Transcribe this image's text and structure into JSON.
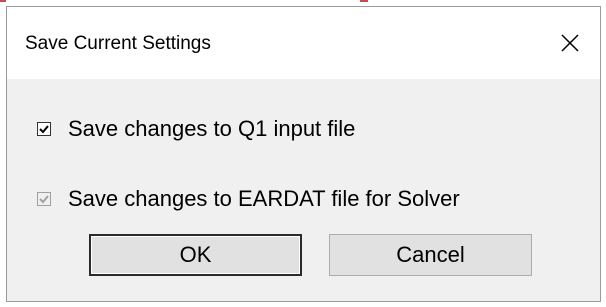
{
  "dialog": {
    "title": "Save Current Settings",
    "close_icon": "close-icon"
  },
  "options": [
    {
      "label": "Save changes to Q1 input file",
      "checked": true,
      "enabled": true
    },
    {
      "label": "Save changes to EARDAT file for Solver",
      "checked": true,
      "enabled": false
    }
  ],
  "buttons": {
    "ok_label": "OK",
    "cancel_label": "Cancel"
  },
  "colors": {
    "checkmark": "#000000",
    "checkmark_disabled": "#a0a0a0",
    "dialog_bg": "#f0f0f0",
    "button_bg": "#e1e1e1"
  }
}
